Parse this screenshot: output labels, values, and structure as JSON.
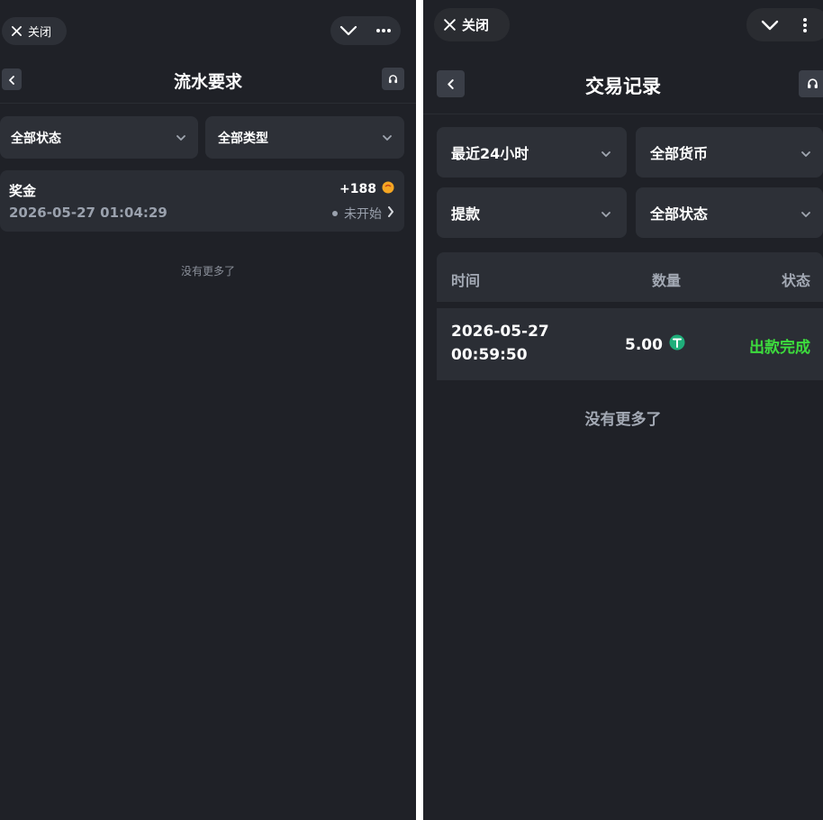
{
  "left": {
    "close_label": "关闭",
    "title": "流水要求",
    "filters": [
      {
        "label": "全部状态"
      },
      {
        "label": "全部类型"
      }
    ],
    "record": {
      "name": "奖金",
      "amount": "+188",
      "datetime": "2026-05-27 01:04:29",
      "status": "未开始"
    },
    "no_more": "没有更多了"
  },
  "right": {
    "close_label": "关闭",
    "title": "交易记录",
    "filters": [
      {
        "label": "最近24小时"
      },
      {
        "label": "全部货币"
      },
      {
        "label": "提款"
      },
      {
        "label": "全部状态"
      }
    ],
    "table": {
      "headers": [
        "时间",
        "数量",
        "状态"
      ],
      "rows": [
        {
          "date": "2026-05-27",
          "time": "00:59:50",
          "amount": "5.00",
          "status": "出款完成"
        }
      ]
    },
    "no_more": "没有更多了"
  },
  "colors": {
    "background": "#1f2127",
    "panel": "#2d3037",
    "success": "#3ddc3d",
    "coin": "#f5a623",
    "usdt": "#1fae7a"
  },
  "icons": [
    "close-icon",
    "chevron-down-icon",
    "more-icon",
    "back-icon",
    "headset-icon",
    "coin-icon",
    "usdt-icon",
    "chevron-right-icon"
  ]
}
